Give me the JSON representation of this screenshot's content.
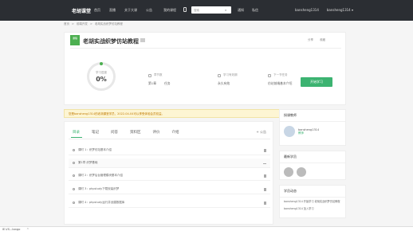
{
  "header": {
    "brand": "老胡课堂",
    "nav": [
      "首页",
      "直播",
      "关于大课",
      "公告"
    ],
    "my_courses": "我的课程",
    "search_placeholder": "搜索",
    "tools": [
      "通知",
      "私信"
    ],
    "user": [
      "bansheng1314",
      "bansheng1314 ▾"
    ]
  },
  "breadcrumb": [
    "首页",
    ">",
    "前端开发",
    ">",
    "老胡实战织梦仿站教程"
  ],
  "course": {
    "tag": "课程",
    "title": "老胡实战织梦仿站教程",
    "actions": [
      "分享",
      "收藏"
    ],
    "progress_label": "学习进度",
    "progress_value": "0%",
    "info": [
      {
        "label": "章节数",
        "values": [
          "第1章",
          "任务"
        ]
      },
      {
        "label": "学习有效期",
        "values": [
          "永久有效"
        ]
      },
      {
        "label": "下一节任务",
        "values": [
          "仿站前端基本介绍"
        ]
      }
    ],
    "learn_button": "开始学习"
  },
  "notice": "您是bansheng1314的老胡课堂学员，2022-04-04可以享受体验会员权益。",
  "tabs": {
    "items": [
      "目录",
      "笔记",
      "问答",
      "资料区",
      "评价",
      "介绍"
    ],
    "active": 0,
    "add_label": "+ 公告"
  },
  "lessons": [
    {
      "text": "课时 1：织梦仿站基本介绍",
      "chapter": false
    },
    {
      "text": "第1章 织梦基础",
      "chapter": true
    },
    {
      "text": "课时 2：织梦后台管理模块基本介绍",
      "chapter": false
    },
    {
      "text": "课时 3：phpstudy下载安装织梦",
      "chapter": false
    },
    {
      "text": "课时 4：phpstudy运行并创建数据库",
      "chapter": false
    }
  ],
  "sidebar": {
    "teacher_title": "授课教师",
    "teacher_name": "bansheng1314",
    "teacher_role": "教师",
    "recent_title": "最新学员",
    "activity_title": "学员动态",
    "activities": [
      "bansheng1314 开始学习 老胡实战织梦仿站教程",
      "bansheng1314 加入学习"
    ]
  },
  "taskbar": [
    "IE-VS...tango",
    "^"
  ]
}
